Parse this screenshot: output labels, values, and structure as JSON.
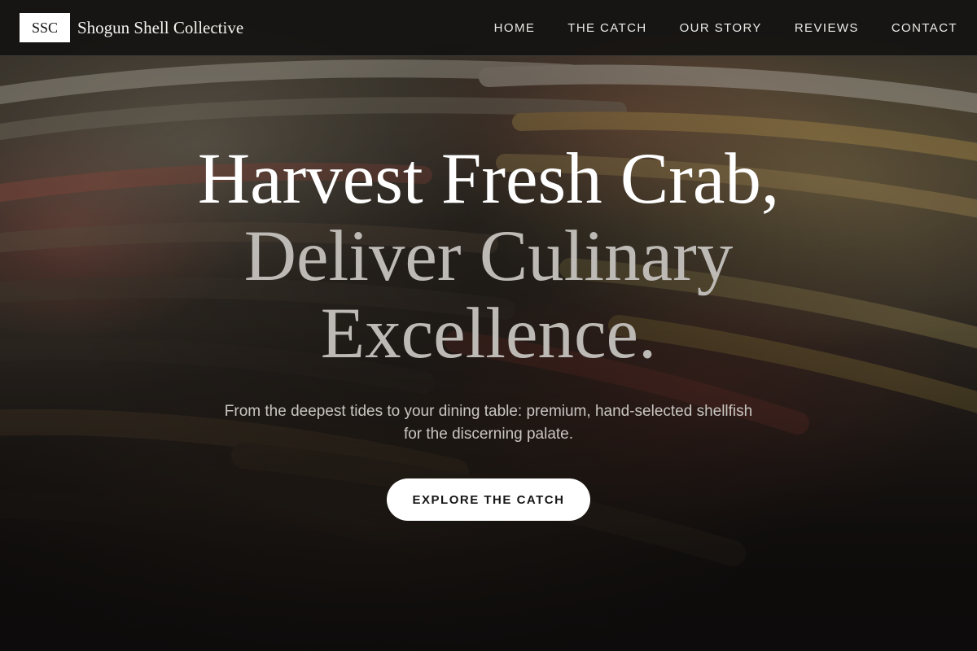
{
  "header": {
    "logo_text": "SSC",
    "brand_name": "Shogun Shell Collective",
    "nav": [
      {
        "label": "HOME"
      },
      {
        "label": "THE CATCH"
      },
      {
        "label": "OUR STORY"
      },
      {
        "label": "REVIEWS"
      },
      {
        "label": "CONTACT"
      }
    ]
  },
  "hero": {
    "title_line_1": "Harvest Fresh Crab,",
    "title_line_2": "Deliver Culinary",
    "title_line_3": "Excellence.",
    "subtitle": "From the deepest tides to your dining table: premium, hand-selected shellfish for the discerning palate.",
    "cta_label": "EXPLORE THE CATCH"
  },
  "colors": {
    "header_bg": "#121110",
    "title_primary": "#ffffff",
    "title_secondary": "#bdbab6",
    "cta_bg": "#ffffff",
    "cta_text": "#161616"
  }
}
